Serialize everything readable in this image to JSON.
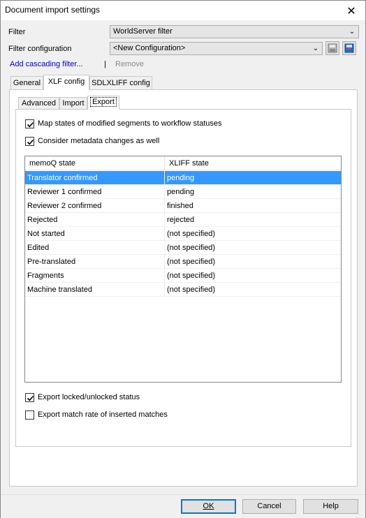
{
  "window": {
    "title": "Document import settings"
  },
  "filter": {
    "label": "Filter",
    "value": "WorldServer filter"
  },
  "filter_config": {
    "label": "Filter configuration",
    "value": "<New Configuration>"
  },
  "links": {
    "add_cascading": "Add cascading filter...",
    "separator": "|",
    "remove": "Remove"
  },
  "tabs": [
    {
      "label": "General"
    },
    {
      "label": "XLF config"
    },
    {
      "label": "SDLXLIFF config"
    }
  ],
  "inner_tabs": [
    {
      "label": "Advanced"
    },
    {
      "label": "Import"
    },
    {
      "label": "Export"
    }
  ],
  "options": {
    "map_states": {
      "label": "Map states of modified segments to workflow statuses",
      "checked": true
    },
    "consider_metadata": {
      "label": "Consider metadata changes as well",
      "checked": true
    },
    "export_locked": {
      "label": "Export locked/unlocked status",
      "checked": true
    },
    "export_match_rate": {
      "label": "Export match rate of inserted matches",
      "checked": false
    }
  },
  "state_table": {
    "columns": [
      "memoQ state",
      "XLIFF state"
    ],
    "rows": [
      [
        "Translator confirmed",
        "pending"
      ],
      [
        "Reviewer 1 confirmed",
        "pending"
      ],
      [
        "Reviewer 2 confirmed",
        "finished"
      ],
      [
        "Rejected",
        "rejected"
      ],
      [
        "Not started",
        "(not specified)"
      ],
      [
        "Edited",
        "(not specified)"
      ],
      [
        "Pre-translated",
        "(not specified)"
      ],
      [
        "Fragments",
        "(not specified)"
      ],
      [
        "Machine translated",
        "(not specified)"
      ]
    ],
    "selected_row": 0
  },
  "buttons": {
    "ok": "OK",
    "cancel": "Cancel",
    "help": "Help"
  },
  "icons": {
    "close": "close-icon",
    "save_config": "save-config-icon",
    "add_config": "add-config-icon",
    "dropdown": "chevron-down-icon"
  }
}
